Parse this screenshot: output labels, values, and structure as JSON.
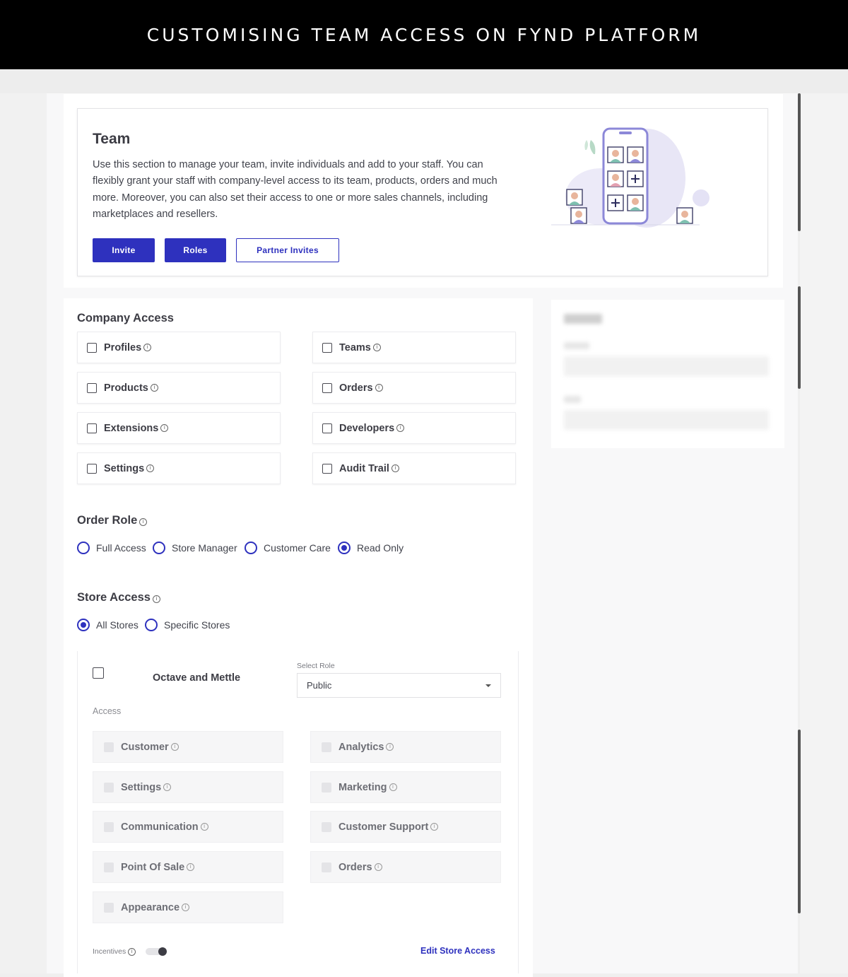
{
  "banner": {
    "title": "CUSTOMISING TEAM ACCESS ON FYND PLATFORM"
  },
  "team": {
    "title": "Team",
    "description": "Use this section to manage your team, invite individuals and add to your staff. You can flexibly grant your staff with company-level access to its team, products, orders and much more. Moreover, you can also set their access to one or more sales channels, including marketplaces and resellers.",
    "buttons": {
      "invite": "Invite",
      "roles": "Roles",
      "partner_invites": "Partner Invites"
    }
  },
  "company_access": {
    "title": "Company Access",
    "items": [
      {
        "label": "Profiles",
        "checked": false
      },
      {
        "label": "Teams",
        "checked": false
      },
      {
        "label": "Products",
        "checked": false
      },
      {
        "label": "Orders",
        "checked": false
      },
      {
        "label": "Extensions",
        "checked": false
      },
      {
        "label": "Developers",
        "checked": false
      },
      {
        "label": "Settings",
        "checked": false
      },
      {
        "label": "Audit Trail",
        "checked": false
      }
    ]
  },
  "order_role": {
    "title": "Order Role",
    "options": [
      "Full Access",
      "Store Manager",
      "Customer Care",
      "Read Only"
    ],
    "selected": "Read Only"
  },
  "store_access": {
    "title": "Store Access",
    "options": [
      "All Stores",
      "Specific Stores"
    ],
    "selected": "All Stores"
  },
  "store_card": {
    "store_name": "Octave and Mettle",
    "select_role_label": "Select Role",
    "select_role_value": "Public",
    "access_label": "Access",
    "items": [
      "Customer",
      "Analytics",
      "Settings",
      "Marketing",
      "Communication",
      "Customer Support",
      "Point Of Sale",
      "Orders",
      "Appearance"
    ],
    "incentives_label": "Incentives",
    "edit_link": "Edit Store Access"
  },
  "colors": {
    "accent": "#2e31be",
    "banner_bg": "#000000",
    "text": "#41434c"
  }
}
